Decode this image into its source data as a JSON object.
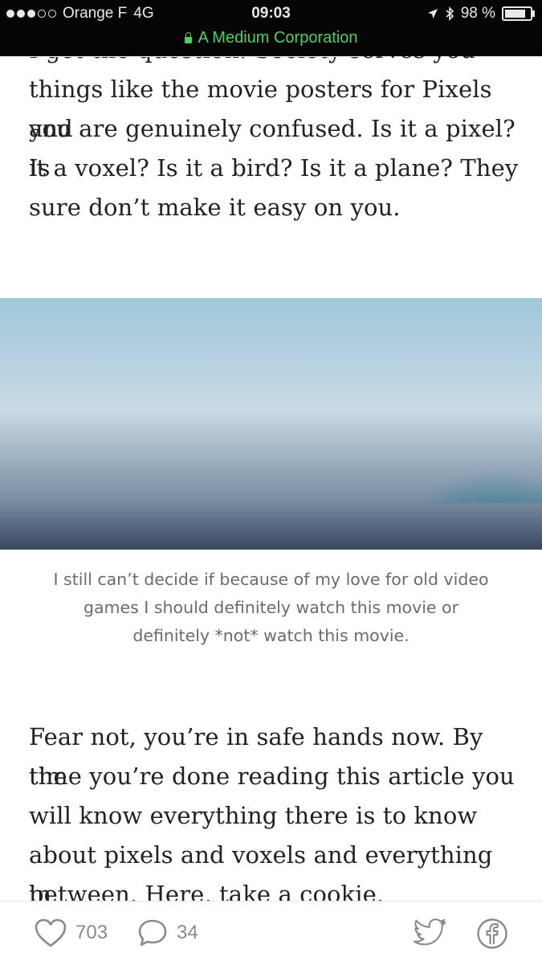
{
  "status_bar": {
    "carrier": "Orange F",
    "network": "4G",
    "time": "09:03",
    "battery": "98 %",
    "battery_level": 0.98,
    "site": "A Medium Corporation"
  },
  "article": {
    "partial_line": "I get the question. Society serves you",
    "paragraph1_lines": [
      "things like the movie posters for Pixels and",
      "you are genuinely confused. Is it a pixel? Is",
      "it a voxel? Is it a bird? Is it a plane? They",
      "sure don’t make it easy on you."
    ],
    "caption_lines": [
      "I still can’t decide if because of my love for old video",
      "games I should definitely watch this movie or",
      "definitely *not* watch this movie."
    ],
    "paragraph2_lines": [
      "Fear not, you’re in safe hands now. By the",
      "time you’re done reading this article you",
      "will know everything there is to know",
      "about pixels and voxels and everything in",
      "between. Here, take a cookie."
    ]
  },
  "action_bar": {
    "recommend_icon": "heart-icon",
    "recommend_count": "703",
    "responses_icon": "speech-bubble-icon",
    "responses_count": "34",
    "twitter_icon": "twitter-icon",
    "facebook_icon": "facebook-icon"
  },
  "colors": {
    "status_bar_bg": "#050505",
    "secure_url": "#4fd160",
    "body_text": "#222222",
    "caption_text": "#6b6b6b",
    "icon_gray": "#8a8a8a"
  }
}
